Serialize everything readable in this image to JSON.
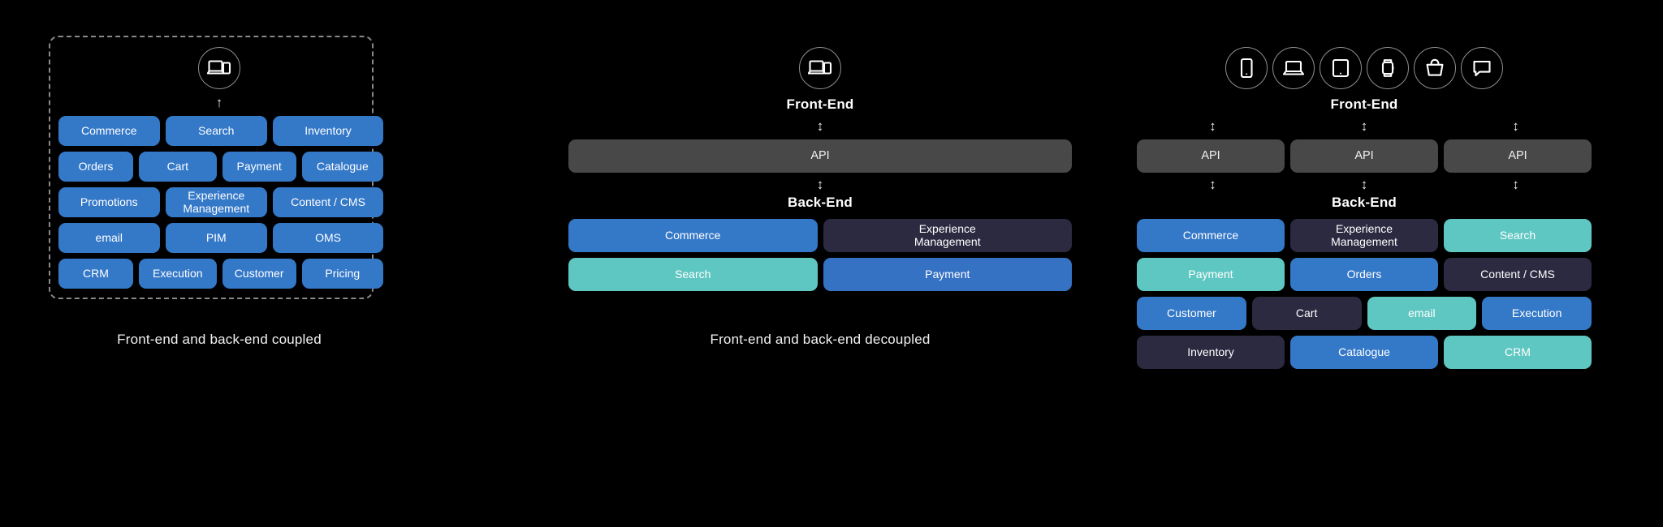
{
  "colors": {
    "background": "#000000",
    "blue": "#3478c8",
    "royal_blue": "#3572c4",
    "teal": "#5fc7c2",
    "dark_purple": "#2b2a41",
    "api_gray": "#484848",
    "dashed_border": "#8a8a8a",
    "text": "#ffffff"
  },
  "panels": [
    {
      "id": "coupled",
      "caption": "Front-end and back-end coupled",
      "device_icons": [
        "laptop-devices-icon"
      ],
      "arrow_up": "↑",
      "tile_rows": [
        [
          {
            "label": "Commerce",
            "color": "blue",
            "flex": 122
          },
          {
            "label": "Search",
            "color": "blue",
            "flex": 123
          },
          {
            "label": "Inventory",
            "color": "blue",
            "flex": 134
          }
        ],
        [
          {
            "label": "Orders",
            "color": "blue",
            "flex": 90
          },
          {
            "label": "Cart",
            "color": "blue",
            "flex": 94
          },
          {
            "label": "Payment",
            "color": "blue",
            "flex": 89
          },
          {
            "label": "Catalogue",
            "color": "blue",
            "flex": 99
          }
        ],
        [
          {
            "label": "Promotions",
            "color": "blue",
            "flex": 122
          },
          {
            "label": "Experience\nManagement",
            "color": "blue",
            "flex": 123
          },
          {
            "label": "Content / CMS",
            "color": "blue",
            "flex": 134
          }
        ],
        [
          {
            "label": "email",
            "color": "blue",
            "flex": 122
          },
          {
            "label": "PIM",
            "color": "blue",
            "flex": 123
          },
          {
            "label": "OMS",
            "color": "blue",
            "flex": 134
          }
        ],
        [
          {
            "label": "CRM",
            "color": "blue",
            "flex": 90
          },
          {
            "label": "Execution",
            "color": "blue",
            "flex": 94
          },
          {
            "label": "Customer",
            "color": "blue",
            "flex": 89
          },
          {
            "label": "Pricing",
            "color": "blue",
            "flex": 99
          }
        ]
      ]
    },
    {
      "id": "decoupled",
      "caption": "Front-end and back-end decoupled",
      "frontend_label": "Front-End",
      "backend_label": "Back-End",
      "api_label": "API",
      "device_icons": [
        "laptop-devices-icon"
      ],
      "arrow": "↕",
      "tile_rows": [
        [
          {
            "label": "Commerce",
            "color": "blue",
            "flex": 1
          },
          {
            "label": "Experience\nManagement",
            "color": "dark_purple",
            "flex": 1
          }
        ],
        [
          {
            "label": "Search",
            "color": "teal",
            "flex": 1
          },
          {
            "label": "Payment",
            "color": "royal_blue",
            "flex": 1
          }
        ]
      ]
    },
    {
      "id": "headless",
      "caption": "",
      "frontend_label": "Front-End",
      "backend_label": "Back-End",
      "api_label": "API",
      "api_count": 3,
      "device_icons": [
        "smartphone-icon",
        "laptop-icon",
        "tablet-icon",
        "smartwatch-icon",
        "shopping-bag-icon",
        "chat-bubble-icon"
      ],
      "arrow": "↕",
      "tile_rows": [
        [
          {
            "label": "Commerce",
            "color": "blue",
            "flex": 1
          },
          {
            "label": "Experience\nManagement",
            "color": "dark_purple",
            "flex": 1
          },
          {
            "label": "Search",
            "color": "teal",
            "flex": 1
          }
        ],
        [
          {
            "label": "Payment",
            "color": "teal",
            "flex": 1
          },
          {
            "label": "Orders",
            "color": "blue",
            "flex": 1
          },
          {
            "label": "Content  / CMS",
            "color": "dark_purple",
            "flex": 1
          }
        ],
        [
          {
            "label": "Customer",
            "color": "blue",
            "flex": 1
          },
          {
            "label": "Cart",
            "color": "dark_purple",
            "flex": 1
          },
          {
            "label": "email",
            "color": "teal",
            "flex": 1
          },
          {
            "label": "Execution",
            "color": "blue",
            "flex": 1
          }
        ],
        [
          {
            "label": "Inventory",
            "color": "dark_purple",
            "flex": 1
          },
          {
            "label": "Catalogue",
            "color": "blue",
            "flex": 1
          },
          {
            "label": "CRM",
            "color": "teal",
            "flex": 1
          }
        ]
      ]
    }
  ]
}
